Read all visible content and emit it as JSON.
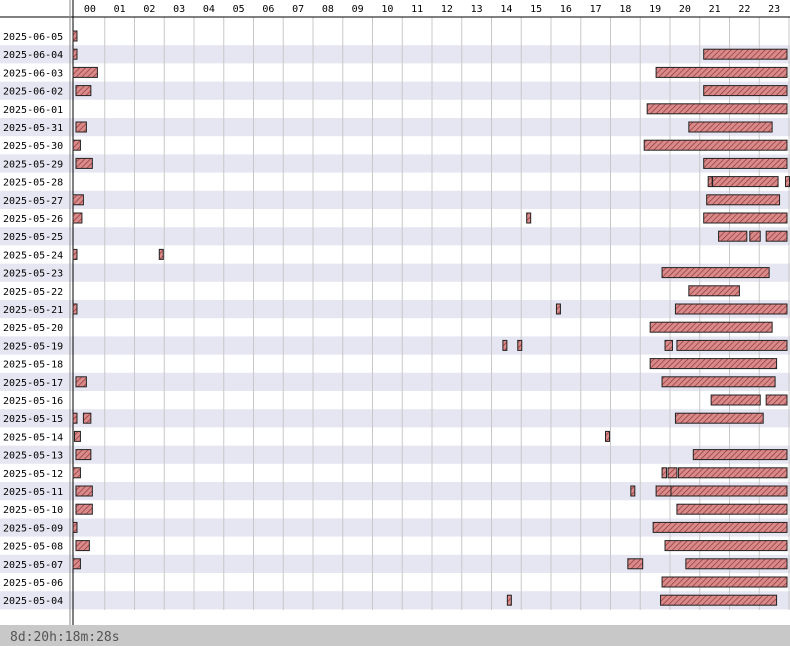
{
  "hours": [
    "00",
    "01",
    "02",
    "03",
    "04",
    "05",
    "06",
    "07",
    "08",
    "09",
    "10",
    "11",
    "12",
    "13",
    "14",
    "15",
    "16",
    "17",
    "18",
    "19",
    "20",
    "21",
    "22",
    "23"
  ],
  "dates": [
    "2025-06-05",
    "2025-06-04",
    "2025-06-03",
    "2025-06-02",
    "2025-06-01",
    "2025-05-31",
    "2025-05-30",
    "2025-05-29",
    "2025-05-28",
    "2025-05-27",
    "2025-05-26",
    "2025-05-25",
    "2025-05-24",
    "2025-05-23",
    "2025-05-22",
    "2025-05-21",
    "2025-05-20",
    "2025-05-19",
    "2025-05-18",
    "2025-05-17",
    "2025-05-16",
    "2025-05-15",
    "2025-05-14",
    "2025-05-13",
    "2025-05-12",
    "2025-05-11",
    "2025-05-10",
    "2025-05-09",
    "2025-05-08",
    "2025-05-07",
    "2025-05-06",
    "2025-05-04"
  ],
  "summary": "8d:20h:18m:28s",
  "colors": {
    "bar_fill": "#d98a8a",
    "bar_stroke": "#222222",
    "row_alt": "#e6e6f2",
    "grid": "#c8c8c8",
    "footer": "#c8c8c8"
  },
  "sessions": [
    [
      [
        0.0,
        0.12
      ]
    ],
    [
      [
        0.0,
        0.1
      ],
      [
        21.2,
        24.0
      ]
    ],
    [
      [
        0.0,
        0.82
      ],
      [
        19.6,
        24.0
      ]
    ],
    [
      [
        0.1,
        0.6
      ],
      [
        21.2,
        24.0
      ]
    ],
    [
      [
        19.3,
        24.0
      ]
    ],
    [
      [
        0.1,
        0.45
      ],
      [
        20.7,
        23.5
      ]
    ],
    [
      [
        0.0,
        0.25
      ],
      [
        19.2,
        24.0
      ]
    ],
    [
      [
        0.1,
        0.65
      ],
      [
        21.2,
        24.0
      ]
    ],
    [
      [
        21.35,
        21.45
      ],
      [
        21.5,
        23.7
      ],
      [
        23.95,
        24.0
      ]
    ],
    [
      [
        0.0,
        0.35
      ],
      [
        21.3,
        23.75
      ]
    ],
    [
      [
        0.0,
        0.3
      ],
      [
        15.25,
        15.38
      ],
      [
        21.2,
        24.0
      ]
    ],
    [
      [
        21.7,
        22.65
      ],
      [
        22.75,
        23.1
      ],
      [
        23.3,
        24.0
      ]
    ],
    [
      [
        0.0,
        0.1
      ],
      [
        2.9,
        3.02
      ]
    ],
    [
      [
        19.8,
        23.4
      ]
    ],
    [
      [
        20.7,
        22.4
      ]
    ],
    [
      [
        0.0,
        0.12
      ],
      [
        16.25,
        16.38
      ],
      [
        20.25,
        24.0
      ]
    ],
    [
      [
        19.4,
        23.5
      ]
    ],
    [
      [
        14.45,
        14.55
      ],
      [
        14.95,
        15.05
      ],
      [
        19.9,
        20.15
      ],
      [
        20.3,
        24.0
      ]
    ],
    [
      [
        19.4,
        23.65
      ]
    ],
    [
      [
        0.1,
        0.45
      ],
      [
        19.8,
        23.6
      ]
    ],
    [
      [
        21.45,
        23.1
      ],
      [
        23.3,
        24.0
      ]
    ],
    [
      [
        0.0,
        0.12
      ],
      [
        0.35,
        0.6
      ],
      [
        20.25,
        23.2
      ]
    ],
    [
      [
        0.05,
        0.25
      ],
      [
        17.9,
        18.03
      ]
    ],
    [
      [
        0.1,
        0.6
      ],
      [
        20.85,
        24.0
      ]
    ],
    [
      [
        0.0,
        0.25
      ],
      [
        19.8,
        19.95
      ],
      [
        20.0,
        20.3
      ],
      [
        20.35,
        24.0
      ]
    ],
    [
      [
        0.1,
        0.65
      ],
      [
        18.75,
        18.85
      ],
      [
        19.6,
        20.1
      ],
      [
        20.1,
        24.0
      ]
    ],
    [
      [
        0.1,
        0.65
      ],
      [
        20.3,
        24.0
      ]
    ],
    [
      [
        0.0,
        0.1
      ],
      [
        19.5,
        24.0
      ]
    ],
    [
      [
        0.1,
        0.55
      ],
      [
        19.9,
        24.0
      ]
    ],
    [
      [
        0.0,
        0.25
      ],
      [
        18.65,
        19.15
      ],
      [
        20.6,
        24.0
      ]
    ],
    [
      [
        19.8,
        24.0
      ]
    ],
    [
      [
        14.6,
        14.72
      ],
      [
        19.75,
        23.65
      ]
    ]
  ]
}
